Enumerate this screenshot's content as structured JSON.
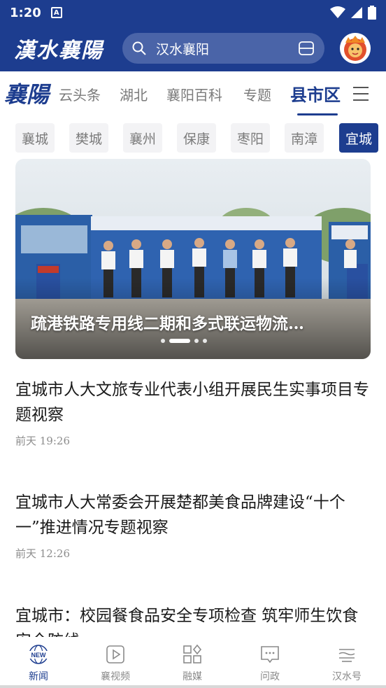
{
  "status_bar": {
    "time": "1:20",
    "app_badge": "A"
  },
  "header": {
    "logo": "漢水襄陽",
    "search_placeholder": "汉水襄阳"
  },
  "channel_nav": {
    "logo": "襄陽",
    "tabs": [
      {
        "label": "云头条",
        "active": false
      },
      {
        "label": "湖北",
        "active": false
      },
      {
        "label": "襄阳百科",
        "active": false
      },
      {
        "label": "专题",
        "active": false
      },
      {
        "label": "县市区",
        "active": true
      }
    ]
  },
  "regions": [
    {
      "label": "襄城",
      "active": false
    },
    {
      "label": "樊城",
      "active": false
    },
    {
      "label": "襄州",
      "active": false
    },
    {
      "label": "保康",
      "active": false
    },
    {
      "label": "枣阳",
      "active": false
    },
    {
      "label": "南漳",
      "active": false
    },
    {
      "label": "宜城",
      "active": true
    }
  ],
  "banner": {
    "title": "疏港铁路专用线二期和多式联运物流…",
    "slide_count": 4,
    "active_slide": 2
  },
  "news": [
    {
      "title": "宜城市人大文旅专业代表小组开展民生实事项目专题视察",
      "time": "前天 19:26"
    },
    {
      "title": " 宜城市人大常委会开展楚都美食品牌建设“十个一”推进情况专题视察",
      "time": "前天 12:26"
    },
    {
      "title": "宜城市：校园餐食品安全专项检查 筑牢师生饮食安全防线",
      "time": ""
    }
  ],
  "bottom_tabs": [
    {
      "label": "新闻",
      "icon": "news-icon",
      "active": true
    },
    {
      "label": "襄视频",
      "icon": "video-icon",
      "active": false
    },
    {
      "label": "融媒",
      "icon": "grid-icon",
      "active": false
    },
    {
      "label": "问政",
      "icon": "chat-icon",
      "active": false
    },
    {
      "label": "汉水号",
      "icon": "wave-icon",
      "active": false
    }
  ],
  "colors": {
    "brand": "#1d3d8f",
    "inactive_text": "#7a7a7a"
  }
}
